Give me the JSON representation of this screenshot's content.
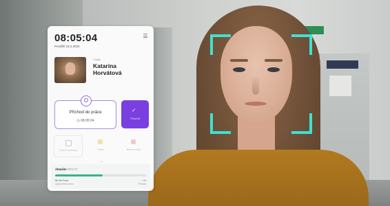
{
  "kiosk": {
    "time": "08:05:04",
    "date": "Pondělí 15.2.2022",
    "user": {
      "label": "Vítejte",
      "first_name": "Katarína",
      "last_name": "Horvátová"
    },
    "checkin": {
      "title": "Příchod do práce",
      "time": "08:05:04"
    },
    "confirm": {
      "label": "Potvrdit"
    },
    "actions": [
      {
        "label": "Změna docházky",
        "icon": "refresh-icon"
      },
      {
        "label": "Lékař",
        "icon": "doctor-icon"
      },
      {
        "label": "Nemocenská",
        "icon": "sick-icon"
      }
    ],
    "status": {
      "label": "Aktuální",
      "state": "PRIVÁT",
      "progress": 0.52,
      "row1": "8h 0m Fond",
      "row2": "odpracováno dnes",
      "right1": "+ 0h",
      "right2": "Přesčas"
    }
  },
  "colors": {
    "accent": "#7a3fe0",
    "detection": "#3fe1d0",
    "progress": "#32b68a"
  }
}
